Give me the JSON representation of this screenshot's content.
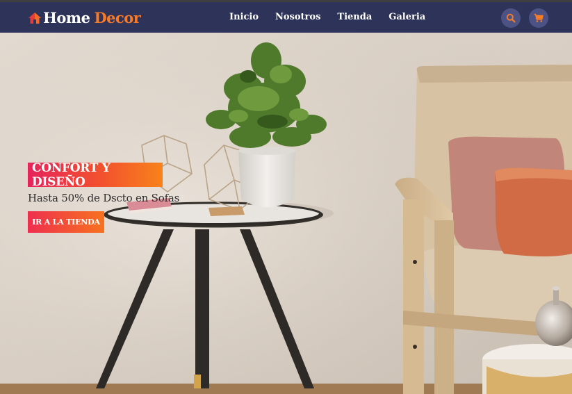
{
  "brand": {
    "word1": "Home",
    "word2": "Decor",
    "icon": "house-icon"
  },
  "nav": {
    "items": [
      {
        "label": "Inicio"
      },
      {
        "label": "Nosotros"
      },
      {
        "label": "Tienda"
      },
      {
        "label": "Galeria"
      }
    ],
    "search_icon": "search-icon",
    "cart_icon": "cart-icon"
  },
  "hero": {
    "tag": "CONFORT Y DISEÑO",
    "subtitle": "Hasta 50% de Dscto en Sofas",
    "cta": "IR A LA TIENDA"
  },
  "colors": {
    "navbar": "#2e3459",
    "accent_orange": "#f57b2a",
    "gradient_start": "#e5245c",
    "gradient_end": "#f8821b",
    "icon_button": "#4c5283"
  }
}
